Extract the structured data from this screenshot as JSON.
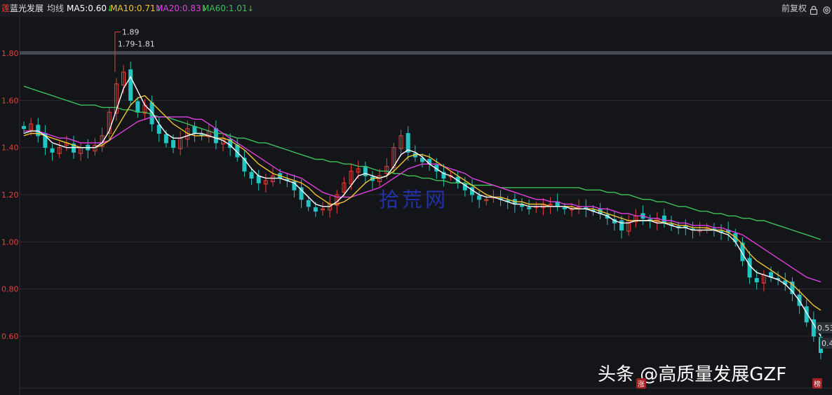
{
  "header": {
    "stock_name_left": "莲",
    "stock_name": "蓝光发展",
    "indicator_label": "均线",
    "ma5": "MA5:0.60",
    "ma10": "MA10:0.71",
    "ma20": "MA20:0.83",
    "ma60": "MA60:1.01",
    "adjust_label": "前复权",
    "down_arrow": "↓",
    "colors": {
      "ma5": "#ffffff",
      "ma10": "#f1c232",
      "ma20": "#e040e0",
      "ma60": "#3fbf5a",
      "arrow": "#3fbf5a"
    }
  },
  "annotations": {
    "high_label": "1.89",
    "range_label": "1.79-1.81",
    "right_label_1": "0.53",
    "right_label_2": "0.4"
  },
  "watermark": "拾荒网",
  "brand_text": "头条 @高质量发展GZF",
  "corner_badges": {
    "left": "涨",
    "right": "榜"
  },
  "chart_data": {
    "type": "candlestick",
    "title": "蓝光发展",
    "y_ticks": [
      "1.80",
      "1.60",
      "1.40",
      "1.20",
      "1.00",
      "0.80",
      "0.60"
    ],
    "ylim": [
      0.44,
      1.95
    ],
    "grid": true,
    "colors": {
      "up": "#e8403a",
      "down": "#22c4c4",
      "ma5": "#ffffff",
      "ma10": "#f1c232",
      "ma20": "#e040e0",
      "ma60": "#3fbf5a"
    },
    "close_path": [
      1.48,
      1.5,
      1.45,
      1.4,
      1.38,
      1.4,
      1.42,
      1.38,
      1.4,
      1.39,
      1.41,
      1.45,
      1.55,
      1.67,
      1.72,
      1.6,
      1.55,
      1.58,
      1.5,
      1.46,
      1.42,
      1.4,
      1.44,
      1.48,
      1.46,
      1.45,
      1.47,
      1.42,
      1.44,
      1.4,
      1.36,
      1.3,
      1.27,
      1.25,
      1.26,
      1.28,
      1.27,
      1.26,
      1.22,
      1.18,
      1.15,
      1.13,
      1.14,
      1.16,
      1.2,
      1.25,
      1.3,
      1.31,
      1.28,
      1.26,
      1.28,
      1.32,
      1.4,
      1.45,
      1.38,
      1.36,
      1.34,
      1.33,
      1.3,
      1.27,
      1.28,
      1.25,
      1.22,
      1.2,
      1.18,
      1.18,
      1.19,
      1.18,
      1.17,
      1.16,
      1.15,
      1.14,
      1.15,
      1.16,
      1.16,
      1.15,
      1.14,
      1.14,
      1.15,
      1.14,
      1.13,
      1.12,
      1.1,
      1.08,
      1.05,
      1.09,
      1.11,
      1.1,
      1.09,
      1.1,
      1.08,
      1.07,
      1.06,
      1.06,
      1.05,
      1.05,
      1.06,
      1.05,
      1.04,
      1.04,
      1.0,
      0.92,
      0.85,
      0.83,
      0.86,
      0.85,
      0.84,
      0.82,
      0.78,
      0.73,
      0.66,
      0.6,
      0.53
    ],
    "ma5_path": [
      1.46,
      1.47,
      1.47,
      1.45,
      1.42,
      1.41,
      1.4,
      1.4,
      1.4,
      1.4,
      1.4,
      1.42,
      1.47,
      1.56,
      1.65,
      1.7,
      1.64,
      1.58,
      1.55,
      1.5,
      1.46,
      1.44,
      1.44,
      1.45,
      1.46,
      1.46,
      1.45,
      1.44,
      1.43,
      1.41,
      1.38,
      1.35,
      1.31,
      1.28,
      1.27,
      1.27,
      1.27,
      1.26,
      1.25,
      1.22,
      1.19,
      1.16,
      1.15,
      1.15,
      1.17,
      1.2,
      1.24,
      1.28,
      1.29,
      1.28,
      1.27,
      1.28,
      1.32,
      1.37,
      1.39,
      1.38,
      1.36,
      1.33,
      1.31,
      1.29,
      1.28,
      1.26,
      1.24,
      1.22,
      1.2,
      1.19,
      1.19,
      1.18,
      1.17,
      1.16,
      1.16,
      1.15,
      1.15,
      1.15,
      1.15,
      1.15,
      1.15,
      1.14,
      1.14,
      1.14,
      1.13,
      1.12,
      1.11,
      1.09,
      1.08,
      1.08,
      1.09,
      1.09,
      1.09,
      1.08,
      1.08,
      1.07,
      1.06,
      1.06,
      1.05,
      1.05,
      1.05,
      1.05,
      1.04,
      1.03,
      1.0,
      0.95,
      0.9,
      0.87,
      0.86,
      0.85,
      0.84,
      0.82,
      0.79,
      0.75,
      0.7,
      0.65,
      0.6
    ],
    "ma10_path": [
      1.45,
      1.46,
      1.46,
      1.45,
      1.44,
      1.43,
      1.42,
      1.41,
      1.4,
      1.4,
      1.4,
      1.41,
      1.43,
      1.48,
      1.53,
      1.58,
      1.61,
      1.62,
      1.59,
      1.56,
      1.53,
      1.5,
      1.48,
      1.46,
      1.45,
      1.45,
      1.45,
      1.44,
      1.44,
      1.43,
      1.41,
      1.39,
      1.36,
      1.33,
      1.31,
      1.29,
      1.28,
      1.27,
      1.26,
      1.25,
      1.23,
      1.2,
      1.18,
      1.16,
      1.16,
      1.17,
      1.19,
      1.22,
      1.25,
      1.27,
      1.27,
      1.28,
      1.3,
      1.33,
      1.36,
      1.37,
      1.37,
      1.36,
      1.34,
      1.32,
      1.3,
      1.28,
      1.26,
      1.24,
      1.22,
      1.2,
      1.19,
      1.19,
      1.18,
      1.17,
      1.17,
      1.16,
      1.16,
      1.16,
      1.15,
      1.15,
      1.15,
      1.15,
      1.14,
      1.14,
      1.14,
      1.13,
      1.12,
      1.11,
      1.1,
      1.09,
      1.09,
      1.09,
      1.09,
      1.09,
      1.08,
      1.08,
      1.07,
      1.07,
      1.06,
      1.06,
      1.06,
      1.05,
      1.05,
      1.04,
      1.02,
      0.99,
      0.95,
      0.92,
      0.9,
      0.88,
      0.86,
      0.84,
      0.82,
      0.79,
      0.76,
      0.73,
      0.71
    ],
    "ma20_path": [
      1.47,
      1.47,
      1.47,
      1.46,
      1.45,
      1.44,
      1.44,
      1.43,
      1.42,
      1.42,
      1.42,
      1.42,
      1.43,
      1.45,
      1.47,
      1.49,
      1.51,
      1.52,
      1.53,
      1.53,
      1.53,
      1.53,
      1.53,
      1.53,
      1.52,
      1.52,
      1.5,
      1.48,
      1.46,
      1.44,
      1.42,
      1.4,
      1.38,
      1.36,
      1.34,
      1.32,
      1.3,
      1.29,
      1.28,
      1.27,
      1.25,
      1.23,
      1.21,
      1.2,
      1.19,
      1.19,
      1.19,
      1.2,
      1.21,
      1.22,
      1.23,
      1.25,
      1.27,
      1.29,
      1.31,
      1.32,
      1.33,
      1.33,
      1.33,
      1.32,
      1.31,
      1.3,
      1.29,
      1.27,
      1.26,
      1.25,
      1.24,
      1.23,
      1.22,
      1.21,
      1.2,
      1.19,
      1.18,
      1.18,
      1.17,
      1.17,
      1.16,
      1.16,
      1.15,
      1.15,
      1.15,
      1.14,
      1.14,
      1.13,
      1.12,
      1.12,
      1.11,
      1.11,
      1.1,
      1.1,
      1.09,
      1.09,
      1.08,
      1.08,
      1.07,
      1.07,
      1.07,
      1.06,
      1.06,
      1.05,
      1.04,
      1.03,
      1.01,
      0.99,
      0.97,
      0.95,
      0.93,
      0.91,
      0.89,
      0.87,
      0.85,
      0.84,
      0.83
    ],
    "ma60_path": [
      1.66,
      1.65,
      1.64,
      1.63,
      1.62,
      1.61,
      1.6,
      1.59,
      1.58,
      1.58,
      1.58,
      1.57,
      1.57,
      1.57,
      1.56,
      1.56,
      1.55,
      1.55,
      1.54,
      1.53,
      1.53,
      1.52,
      1.51,
      1.5,
      1.49,
      1.48,
      1.47,
      1.46,
      1.46,
      1.45,
      1.44,
      1.44,
      1.43,
      1.42,
      1.42,
      1.41,
      1.4,
      1.39,
      1.38,
      1.37,
      1.36,
      1.35,
      1.35,
      1.34,
      1.34,
      1.33,
      1.33,
      1.32,
      1.32,
      1.31,
      1.3,
      1.3,
      1.29,
      1.29,
      1.28,
      1.28,
      1.27,
      1.27,
      1.26,
      1.26,
      1.25,
      1.25,
      1.25,
      1.24,
      1.24,
      1.24,
      1.24,
      1.23,
      1.23,
      1.23,
      1.23,
      1.23,
      1.23,
      1.23,
      1.23,
      1.23,
      1.23,
      1.23,
      1.23,
      1.22,
      1.22,
      1.22,
      1.21,
      1.21,
      1.2,
      1.2,
      1.19,
      1.18,
      1.18,
      1.17,
      1.17,
      1.16,
      1.15,
      1.15,
      1.14,
      1.13,
      1.13,
      1.12,
      1.12,
      1.11,
      1.11,
      1.1,
      1.1,
      1.09,
      1.09,
      1.08,
      1.07,
      1.06,
      1.05,
      1.04,
      1.03,
      1.02,
      1.01
    ]
  }
}
